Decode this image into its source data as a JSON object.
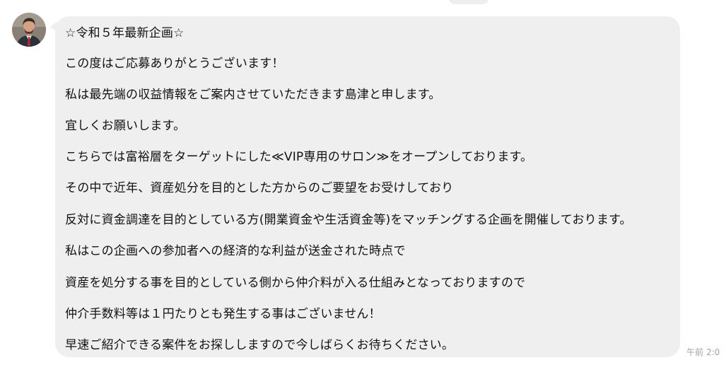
{
  "conversation": {
    "sender_avatar_icon": "avatar-portrait",
    "message": {
      "lines": [
        "☆令和５年最新企画☆",
        "この度はご応募ありがとうございます！",
        "私は最先端の収益情報をご案内させていただきます島津と申します。",
        "宜しくお願いします。",
        "こちらでは富裕層をターゲットにした≪VIP専用のサロン≫をオープンしております。",
        "その中で近年、資産処分を目的とした方からのご要望をお受けしており",
        "反対に資金調達を目的としている方(開業資金や生活資金等)をマッチングする企画を開催しております。",
        "私はこの企画への参加者への経済的な利益が送金された時点で",
        "資産を処分する事を目的としている側から仲介料が入る仕組みとなっておりますので",
        "仲介手数料等は１円たりとも発生する事はございません！",
        "早速ご紹介できる案件をお探ししますので今しばらくお待ちください。"
      ],
      "timestamp": "午前 2:0"
    }
  },
  "colors": {
    "bubble_background": "#efefef",
    "text": "#111111",
    "timestamp": "#a3a3a3"
  }
}
